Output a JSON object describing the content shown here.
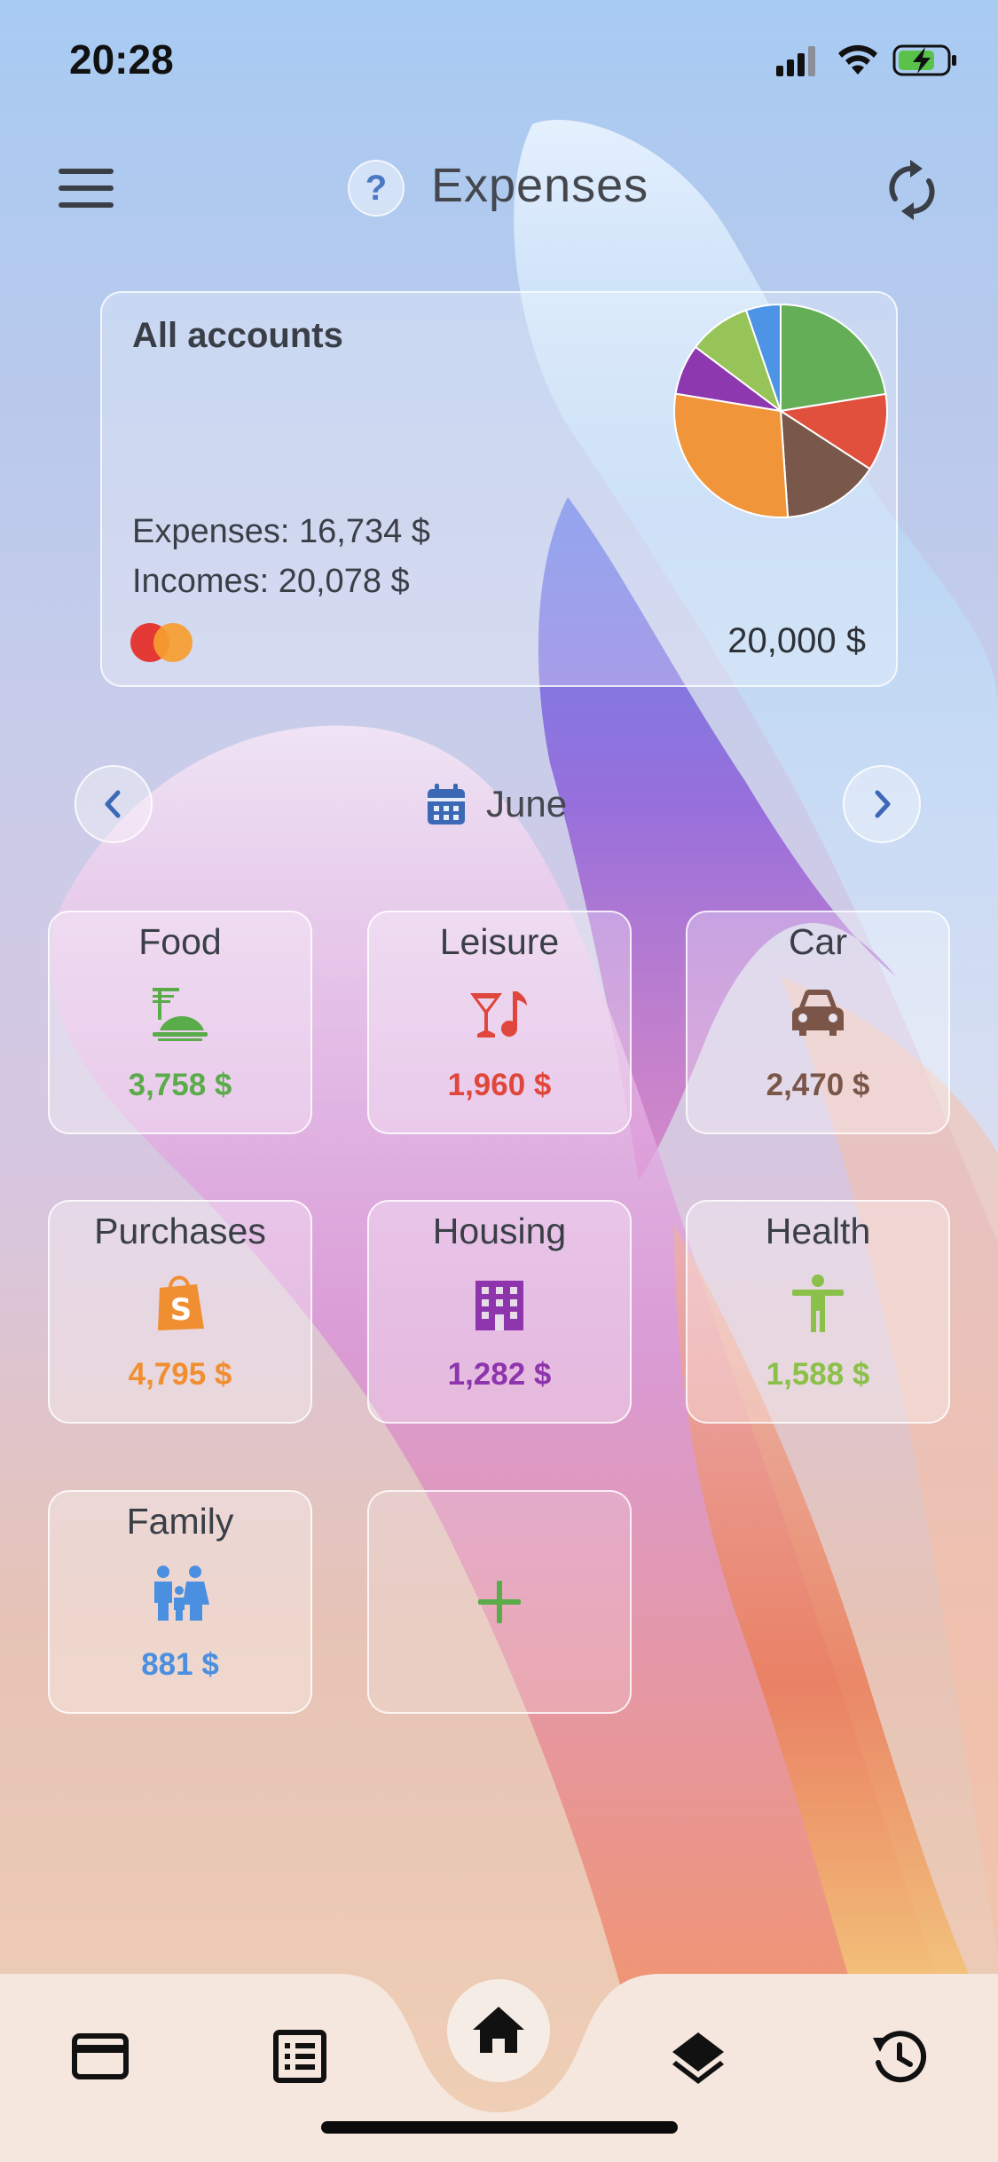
{
  "status_bar": {
    "time": "20:28"
  },
  "header": {
    "title": "Expenses",
    "help_label": "?",
    "menu_icon": "hamburger-menu-icon",
    "refresh_icon": "refresh-icon"
  },
  "account_card": {
    "title": "All accounts",
    "expenses": "Expenses: 16,734 $",
    "incomes": "Incomes: 20,078 $",
    "balance": "20,000 $",
    "card_brand_icon": "mastercard-logo-icon"
  },
  "month_nav": {
    "month": "June",
    "calendar_icon": "calendar-icon",
    "prev_icon": "chevron-left-icon",
    "next_icon": "chevron-right-icon"
  },
  "categories": [
    {
      "name": "Food",
      "amount": "3,758 $",
      "color": "#5aab4a",
      "icon": "dinner-plate-icon"
    },
    {
      "name": "Leisure",
      "amount": "1,960 $",
      "color": "#e0473c",
      "icon": "cocktail-music-icon"
    },
    {
      "name": "Car",
      "amount": "2,470 $",
      "color": "#7a5548",
      "icon": "car-icon"
    },
    {
      "name": "Purchases",
      "amount": "4,795 $",
      "color": "#f08f32",
      "icon": "shopping-bag-icon"
    },
    {
      "name": "Housing",
      "amount": "1,282 $",
      "color": "#8e34ad",
      "icon": "apartment-building-icon"
    },
    {
      "name": "Health",
      "amount": "1,588 $",
      "color": "#8bc04a",
      "icon": "person-accessibility-icon"
    },
    {
      "name": "Family",
      "amount": "881 $",
      "color": "#4a8fe0",
      "icon": "family-icon"
    }
  ],
  "add_category": {
    "label": "+",
    "color": "#5aab4a"
  },
  "bottom_nav": {
    "items": [
      "card-icon",
      "list-icon",
      "home-icon",
      "layers-icon",
      "history-icon"
    ],
    "active": "home-icon"
  },
  "chart_data": {
    "type": "pie",
    "title": "",
    "slices": [
      {
        "label": "Food",
        "value": 3758,
        "color": "#63ae56"
      },
      {
        "label": "Leisure",
        "value": 1960,
        "color": "#e0503c"
      },
      {
        "label": "Car",
        "value": 2470,
        "color": "#79584b"
      },
      {
        "label": "Purchases",
        "value": 4795,
        "color": "#f0953a"
      },
      {
        "label": "Housing",
        "value": 1282,
        "color": "#8e38b0"
      },
      {
        "label": "Health",
        "value": 1588,
        "color": "#96c459"
      },
      {
        "label": "Family",
        "value": 881,
        "color": "#4d93e6"
      }
    ]
  }
}
